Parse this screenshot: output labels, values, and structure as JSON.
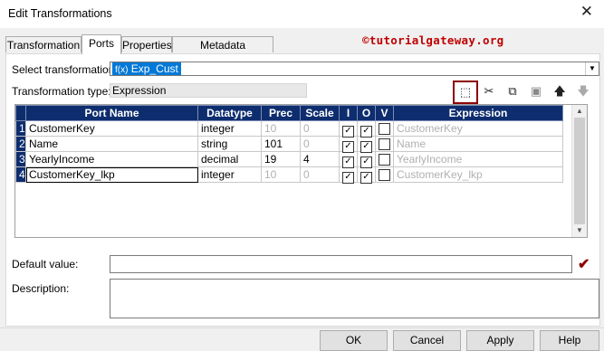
{
  "window": {
    "title": "Edit Transformations",
    "close_glyph": "✕"
  },
  "tabs": [
    {
      "label": "Transformation"
    },
    {
      "label": "Ports"
    },
    {
      "label": "Properties"
    },
    {
      "label": "Metadata Extensions"
    }
  ],
  "watermark": "©tutorialgateway.org",
  "select_transformation": {
    "label": "Select transformation:",
    "icon": "f(x)",
    "value": "Exp_Cust"
  },
  "transformation_type": {
    "label": "Transformation type:",
    "value": "Expression"
  },
  "toolbar": {
    "icons": [
      "new-port-icon",
      "cut-icon",
      "copy-icon",
      "paste-icon",
      "move-up-icon",
      "move-down-icon"
    ],
    "glyphs": [
      "⬚",
      "✂",
      "⧉",
      "▣",
      "🡅",
      "🡇"
    ]
  },
  "grid": {
    "columns": [
      "",
      "Port Name",
      "Datatype",
      "Prec",
      "Scale",
      "I",
      "O",
      "V",
      "Expression"
    ],
    "rows": [
      {
        "num": "1",
        "name": "CustomerKey",
        "datatype": "integer",
        "prec": "10",
        "scale": "0",
        "i": true,
        "o": true,
        "v": false,
        "expression": "CustomerKey"
      },
      {
        "num": "2",
        "name": "Name",
        "datatype": "string",
        "prec": "101",
        "scale": "0",
        "i": true,
        "o": true,
        "v": false,
        "expression": "Name"
      },
      {
        "num": "3",
        "name": "YearlyIncome",
        "datatype": "decimal",
        "prec": "19",
        "scale": "4",
        "i": true,
        "o": true,
        "v": false,
        "expression": "YearlyIncome"
      },
      {
        "num": "4",
        "name": "CustomerKey_lkp",
        "datatype": "integer",
        "prec": "10",
        "scale": "0",
        "i": true,
        "o": true,
        "v": false,
        "expression": "CustomerKey_lkp"
      }
    ]
  },
  "default_value": {
    "label": "Default value:",
    "value": ""
  },
  "description": {
    "label": "Description:",
    "value": ""
  },
  "buttons": {
    "ok": "OK",
    "cancel": "Cancel",
    "apply": "Apply",
    "help": "Help"
  },
  "colors": {
    "header_bg": "#0d2d6e",
    "highlight_border": "#8b0000",
    "watermark": "#c00000",
    "selection": "#0078d7"
  }
}
